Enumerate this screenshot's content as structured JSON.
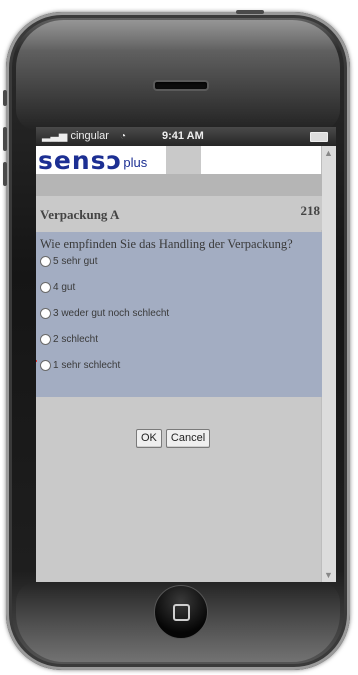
{
  "status_bar": {
    "carrier": "cingular",
    "time": "9:41 AM"
  },
  "logo": {
    "main": "sensɔ",
    "sub": "plus"
  },
  "card": {
    "title": "Verpackung A",
    "number": "218"
  },
  "question": {
    "text": "Wie empfinden Sie das Handling der Verpackung?",
    "options": [
      {
        "label": "5 sehr gut",
        "selected": false
      },
      {
        "label": "4 gut",
        "selected": false
      },
      {
        "label": "3 weder gut noch schlecht",
        "selected": false
      },
      {
        "label": "2 schlecht",
        "selected": false
      },
      {
        "label": "1 sehr schlecht",
        "selected": false
      }
    ]
  },
  "buttons": {
    "ok": "OK",
    "cancel": "Cancel"
  },
  "colors": {
    "brand": "#1c2f93",
    "panel": "#a3adc2",
    "screen_bg": "#c9c9c9"
  }
}
